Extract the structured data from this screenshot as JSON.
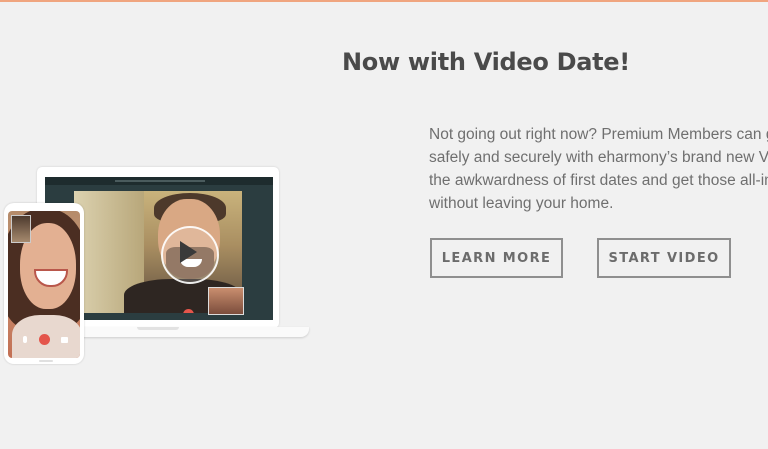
{
  "promo": {
    "heading": "Now with Video Date!",
    "body_lines": [
      "Not going out right now? Premium Members can ge",
      "safely and securely with eharmony’s brand new Vid",
      "the awkwardness of first dates and get those all-im",
      "without leaving your home."
    ],
    "learn_more_label": "LEARN MORE",
    "start_video_label": "START VIDEO"
  },
  "colors": {
    "background": "#f1f1f1",
    "accent_top_bar": "#f0a57f",
    "heading": "#4a4a4a",
    "body_text": "#6f6f6f",
    "button_border": "#8f8f8f",
    "end_call": "#e4554b"
  },
  "illustration": {
    "icons": [
      "play-icon",
      "end-call-icon",
      "more-dots-icon",
      "microphone-icon",
      "camera-icon"
    ]
  }
}
